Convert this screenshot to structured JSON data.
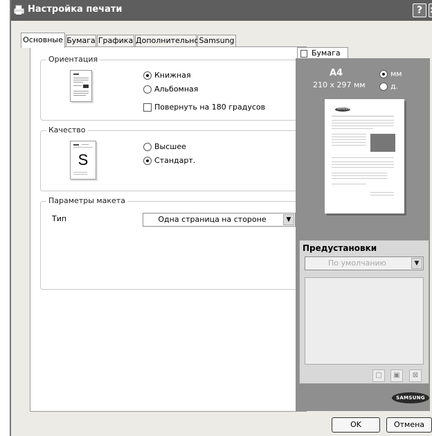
{
  "window": {
    "title": "Настройка печати",
    "help_label": "?",
    "close_label": "×"
  },
  "tabs": [
    {
      "label": "Основные"
    },
    {
      "label": "Бумага"
    },
    {
      "label": "Графика"
    },
    {
      "label": "Дополнительно"
    },
    {
      "label": "Samsung"
    }
  ],
  "orientation": {
    "legend": "Ориентация",
    "portrait": "Книжная",
    "landscape": "Альбомная",
    "rotate": "Повернуть на 180 градусов",
    "selected": "portrait"
  },
  "quality": {
    "legend": "Качество",
    "high": "Высшее",
    "standard": "Стандарт.",
    "icon_letter": "S",
    "selected": "standard"
  },
  "layout": {
    "legend": "Параметры макета",
    "type_label": "Тип",
    "type_value": "Одна страница на стороне"
  },
  "preview": {
    "tab_label": "Бумага",
    "paper_name": "A4",
    "paper_dims": "210 x 297 мм",
    "unit_mm": "мм",
    "unit_in": "д."
  },
  "presets": {
    "title": "Предустановки",
    "value": "По умолчанию"
  },
  "brand": {
    "logo_text": "SAMSUNG",
    "preview_logo_text": "SAMSUNG"
  },
  "buttons": {
    "ok": "OK",
    "cancel": "Отмена"
  }
}
